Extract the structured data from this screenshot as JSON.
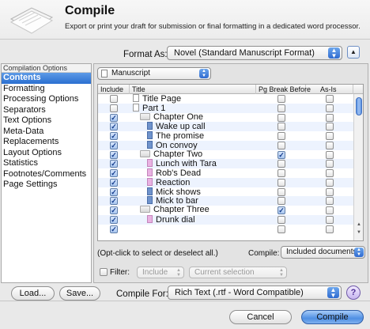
{
  "header": {
    "title": "Compile",
    "subtitle": "Export or print your draft for submission or final formatting in a dedicated word processor."
  },
  "format_as": {
    "label": "Format As:",
    "value": "Novel (Standard Manuscript Format)"
  },
  "sidebar": {
    "heading": "Compilation Options",
    "items": [
      {
        "label": "Contents",
        "selected": true
      },
      {
        "label": "Formatting"
      },
      {
        "label": "Processing Options"
      },
      {
        "label": "Separators"
      },
      {
        "label": "Text Options"
      },
      {
        "label": "Meta-Data"
      },
      {
        "label": "Replacements"
      },
      {
        "label": "Layout Options"
      },
      {
        "label": "Statistics"
      },
      {
        "label": "Footnotes/Comments"
      },
      {
        "label": "Page Settings"
      }
    ]
  },
  "contents": {
    "collection": "Manuscript",
    "columns": {
      "include": "Include",
      "title": "Title",
      "pg_break": "Pg Break Before",
      "as_is": "As-Is"
    },
    "rows": [
      {
        "title": "Title Page",
        "level": 0,
        "icon": "document-icon",
        "include": false,
        "pg_break": false,
        "as_is": false
      },
      {
        "title": "Part 1",
        "level": 0,
        "icon": "document-icon",
        "include": false,
        "pg_break": false,
        "as_is": false
      },
      {
        "title": "Chapter One",
        "level": 1,
        "icon": "folder-icon",
        "include": true,
        "pg_break": false,
        "as_is": false
      },
      {
        "title": "Wake up call",
        "level": 2,
        "icon": "blue-text-icon",
        "include": true,
        "pg_break": false,
        "as_is": false
      },
      {
        "title": "The promise",
        "level": 2,
        "icon": "blue-text-icon",
        "include": true,
        "pg_break": false,
        "as_is": false
      },
      {
        "title": "On convoy",
        "level": 2,
        "icon": "blue-text-icon",
        "include": true,
        "pg_break": false,
        "as_is": false
      },
      {
        "title": "Chapter Two",
        "level": 1,
        "icon": "folder-icon",
        "include": true,
        "pg_break": true,
        "as_is": false
      },
      {
        "title": "Lunch with Tara",
        "level": 2,
        "icon": "pink-text-icon",
        "include": true,
        "pg_break": false,
        "as_is": false
      },
      {
        "title": "Rob's Dead",
        "level": 2,
        "icon": "pink-text-icon",
        "include": true,
        "pg_break": false,
        "as_is": false
      },
      {
        "title": "Reaction",
        "level": 2,
        "icon": "pink-text-icon",
        "include": true,
        "pg_break": false,
        "as_is": false
      },
      {
        "title": "Mick shows",
        "level": 2,
        "icon": "blue-text-icon",
        "include": true,
        "pg_break": false,
        "as_is": false
      },
      {
        "title": "Mick to bar",
        "level": 2,
        "icon": "blue-text-icon",
        "include": true,
        "pg_break": false,
        "as_is": false
      },
      {
        "title": "Chapter Three",
        "level": 1,
        "icon": "folder-icon",
        "include": true,
        "pg_break": true,
        "as_is": false
      },
      {
        "title": "Drunk dial",
        "level": 2,
        "icon": "pink-text-icon",
        "include": true,
        "pg_break": false,
        "as_is": false
      },
      {
        "title": "",
        "level": 2,
        "icon": "",
        "include": true,
        "pg_break": false,
        "as_is": false
      }
    ],
    "hint": "(Opt-click to select or deselect all.)",
    "compile_label": "Compile:",
    "compile_value": "Included documents",
    "filter": {
      "label": "Filter:",
      "mode": "Include",
      "selection": "Current selection",
      "enabled": false
    }
  },
  "footer": {
    "load": "Load...",
    "save": "Save...",
    "compile_for_label": "Compile For:",
    "compile_for_value": "Rich Text (.rtf - Word Compatible)",
    "help": "?",
    "cancel": "Cancel",
    "compile": "Compile"
  },
  "colors": {
    "selection": "#3a7bd8",
    "row_alt": "#edf3fe",
    "default_button": "#5d98e6"
  }
}
